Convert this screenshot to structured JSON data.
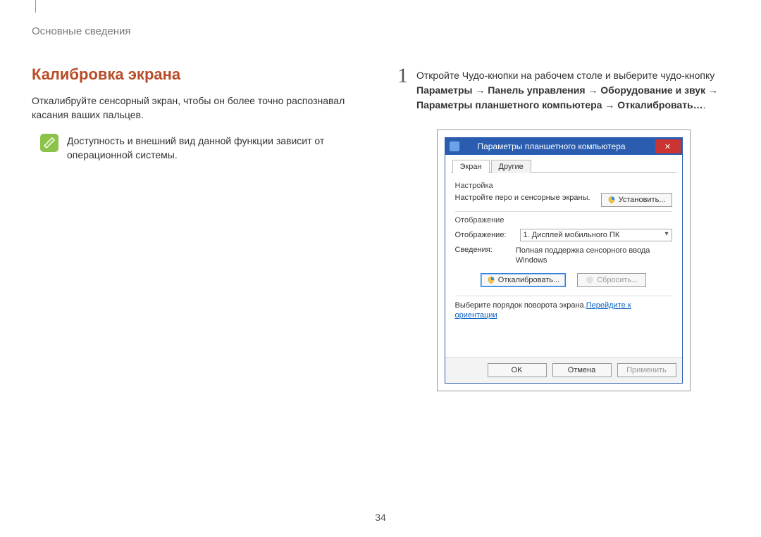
{
  "breadcrumb": "Основные сведения",
  "heading": "Калибровка экрана",
  "intro": "Откалибруйте сенсорный экран, чтобы он более точно распознавал касания ваших пальцев.",
  "note": "Доступность и внешний вид данной функции зависит от операционной системы.",
  "step": {
    "number": "1",
    "text_prefix": "Откройте Чудо-кнопки на рабочем столе и выберите чудо-кнопку ",
    "path1": "Параметры",
    "arrow": " → ",
    "path2": "Панель управления",
    "path3": "Оборудование и звук",
    "path4": "Параметры планшетного компьютера",
    "path5": "Откалибровать…",
    "period": "."
  },
  "dialog": {
    "title": "Параметры планшетного компьютера",
    "close": "✕",
    "tab_screen": "Экран",
    "tab_other": "Другие",
    "group_setup": "Настройка",
    "setup_text": "Настройте перо и сенсорные экраны.",
    "btn_setup": "Установить...",
    "group_display": "Отображение",
    "display_label": "Отображение:",
    "display_value": "1. Дисплей мобильного ПК",
    "info_label": "Сведения:",
    "info_value": "Полная поддержка сенсорного ввода Windows",
    "btn_calibrate": "Откалибровать...",
    "btn_reset": "Сбросить...",
    "rotation_prefix": "Выберите порядок поворота экрана.",
    "rotation_link": "Перейдите к ориентации",
    "btn_ok": "OK",
    "btn_cancel": "Отмена",
    "btn_apply": "Применить"
  },
  "page_number": "34"
}
